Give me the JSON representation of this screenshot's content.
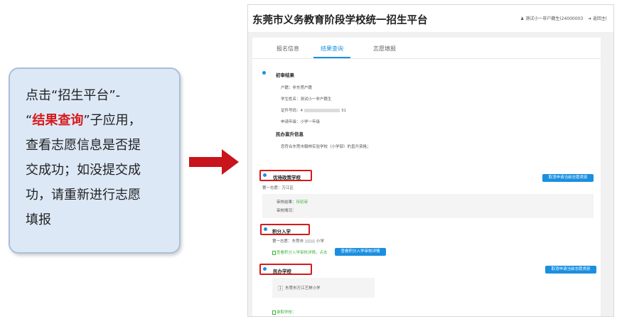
{
  "callout": {
    "line1": "点击“招生平台”-",
    "q_open": "“",
    "highlight": "结果查询",
    "q_close_rest": "”子应用，",
    "line3": "查看志愿信息是否提",
    "line4": "交成功；如没提交成",
    "line5": "功，请重新进行志愿",
    "line6": "填报"
  },
  "app": {
    "title": "东莞市义务教育阶段学校统一招生平台",
    "user_info": "测试小一非户籍生(24000003",
    "back_label": "返回主l"
  },
  "tabs": [
    "报名信息",
    "结果查询",
    "志愿填报"
  ],
  "initial": {
    "title": "初审结果",
    "hukou": "户籍：非东莞户籍",
    "name": "学生姓名：测试小一非户籍生",
    "id_prefix": "证件号码：4",
    "id_suffix": "31",
    "grade": "申请年级：小学一年级",
    "promo_title": "民办直升信息",
    "promo_text": "您符合东莞市翰林实验学校（小学部）的直升资格；"
  },
  "priority": {
    "title": "优待政策学校",
    "first_choice": "第一志愿：万江区",
    "review_label": "审核结果：",
    "review_value": "待初审",
    "review_status": "审核情况：",
    "cancel_button": "取消申请当前志愿类别"
  },
  "points": {
    "title": "积分入学",
    "first_choice_prefix": "第一志愿：东莞市",
    "first_choice_suffix": "小学",
    "link_text": "查看积分入学审核详情，点击",
    "view_button": "查看积分入学审核详情"
  },
  "private": {
    "title": "民办学校",
    "cancel_button": "取消申请当前志愿类别",
    "school_index": "1",
    "school_name": "东莞市万江艺林小学",
    "admitted": "录取学校："
  }
}
